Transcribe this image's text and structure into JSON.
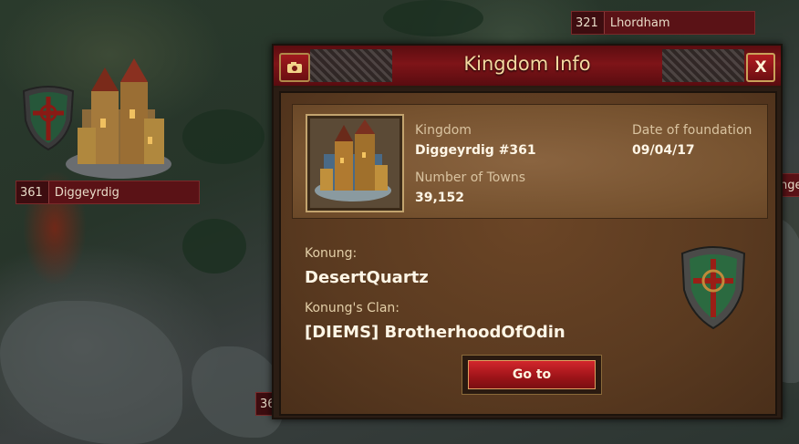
{
  "map": {
    "labels": [
      {
        "number": "321",
        "name": "Lhordham"
      },
      {
        "number": "361",
        "name": "Diggeyrdig"
      }
    ],
    "partial_label_left": "36",
    "partial_label_right": "nge"
  },
  "dialog": {
    "title": "Kingdom Info",
    "close_label": "X",
    "kingdom_label": "Kingdom",
    "kingdom_value": "Diggeyrdig #361",
    "date_label": "Date of foundation",
    "date_value": "09/04/17",
    "towns_label": "Number of Towns",
    "towns_value": "39,152",
    "konung_label": "Konung:",
    "konung_value": "DesertQuartz",
    "clan_label": "Konung's Clan:",
    "clan_value": "[DIEMS] BrotherhoodOfOdin",
    "goto_label": "Go to"
  },
  "colors": {
    "title_bar": "#7e1418",
    "accent_gold": "#c9a25a",
    "button_red": "#b21c20",
    "panel_brown": "#5a3a20"
  }
}
